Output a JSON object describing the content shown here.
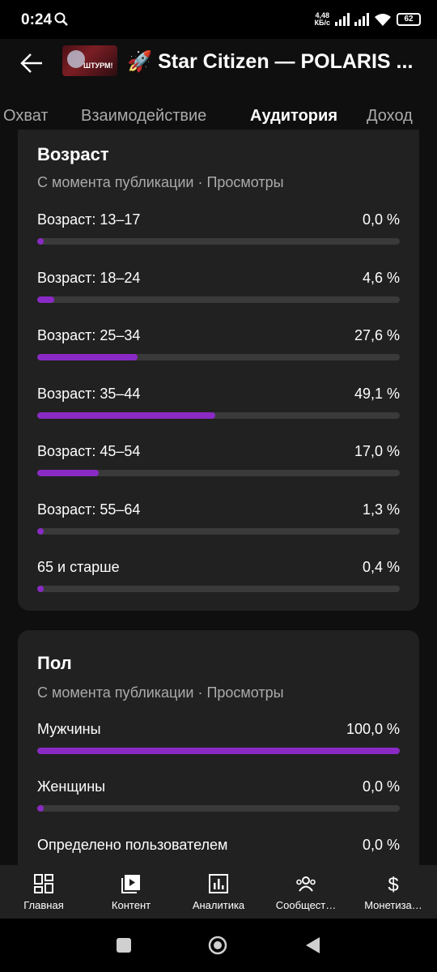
{
  "status_bar": {
    "time": "0:24",
    "net_speed_value": "4,48",
    "net_speed_unit": "КБ/с",
    "battery": "62"
  },
  "header": {
    "thumbnail_caption": "ШТУРМ!",
    "title": "🚀 Star Citizen — POLARIS ..."
  },
  "tabs": [
    {
      "label": "Охват"
    },
    {
      "label": "Взаимодействие"
    },
    {
      "label": "Аудитория"
    },
    {
      "label": "Доход"
    }
  ],
  "age_card": {
    "title": "Возраст",
    "subtitle": "С момента публикации · Просмотры",
    "rows": [
      {
        "label": "Возраст: 13–17",
        "value": "0,0 %",
        "percent": 0.0
      },
      {
        "label": "Возраст: 18–24",
        "value": "4,6 %",
        "percent": 4.6
      },
      {
        "label": "Возраст: 25–34",
        "value": "27,6 %",
        "percent": 27.6
      },
      {
        "label": "Возраст: 35–44",
        "value": "49,1 %",
        "percent": 49.1
      },
      {
        "label": "Возраст: 45–54",
        "value": "17,0 %",
        "percent": 17.0
      },
      {
        "label": "Возраст: 55–64",
        "value": "1,3 %",
        "percent": 1.3
      },
      {
        "label": "65 и старше",
        "value": "0,4 %",
        "percent": 0.4
      }
    ]
  },
  "gender_card": {
    "title": "Пол",
    "subtitle": "С момента публикации · Просмотры",
    "rows": [
      {
        "label": "Мужчины",
        "value": "100,0 %",
        "percent": 100.0
      },
      {
        "label": "Женщины",
        "value": "0,0 %",
        "percent": 0.0
      },
      {
        "label": "Определено пользователем",
        "value": "0,0 %",
        "percent": 0.0
      }
    ]
  },
  "bottom_nav": [
    {
      "label": "Главная",
      "icon": "dashboard-icon"
    },
    {
      "label": "Контент",
      "icon": "content-icon"
    },
    {
      "label": "Аналитика",
      "icon": "analytics-icon"
    },
    {
      "label": "Сообщест…",
      "icon": "community-icon"
    },
    {
      "label": "Монетиза…",
      "icon": "dollar-icon"
    }
  ],
  "colors": {
    "accent": "#8a2ac4",
    "track": "#3a3a3a",
    "card": "#212121",
    "background": "#0f0f0f"
  }
}
